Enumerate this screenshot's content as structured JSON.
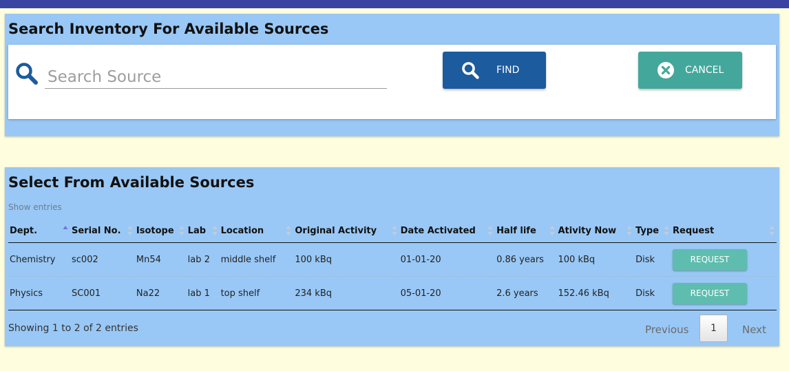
{
  "colors": {
    "top_bar": "#3a44a3",
    "panel": "#99c8f6",
    "find_button": "#1c5b9d",
    "cancel_button": "#43a89b",
    "request_button": "#5ebdaf",
    "page_background": "#fefedf"
  },
  "search_panel": {
    "title": "Search Inventory For Available Sources",
    "search_icon": "magnifier-icon",
    "search_placeholder": "Search Source",
    "search_value": "",
    "find_label": "FIND",
    "find_icon": "magnifier-icon",
    "cancel_label": "CANCEL",
    "cancel_icon": "close-circle-icon"
  },
  "table_panel": {
    "title": "Select From Available Sources",
    "show_entries": "Show entries",
    "columns": [
      "Dept.",
      "Serial No.",
      "Isotope",
      "Lab",
      "Location",
      "Original Activity",
      "Date Activated",
      "Half life",
      "Ativity Now",
      "Type",
      "Request"
    ],
    "sorted_column": "Dept.",
    "rows": [
      {
        "dept": "Chemistry",
        "serial": "sc002",
        "isotope": "Mn54",
        "lab": "lab 2",
        "location": "middle shelf",
        "original_activity": "100 kBq",
        "date_activated": "01-01-20",
        "half_life": "0.86 years",
        "activity_now": "100 kBq",
        "type": "Disk",
        "request_label": "REQUEST"
      },
      {
        "dept": "Physics",
        "serial": "SC001",
        "isotope": "Na22",
        "lab": "lab 1",
        "location": "top shelf",
        "original_activity": "234 kBq",
        "date_activated": "05-01-20",
        "half_life": "2.6 years",
        "activity_now": "152.46 kBq",
        "type": "Disk",
        "request_label": "REQUEST"
      }
    ],
    "info": "Showing 1 to 2 of 2 entries",
    "pagination": {
      "previous": "Previous",
      "current_page": "1",
      "next": "Next"
    }
  }
}
